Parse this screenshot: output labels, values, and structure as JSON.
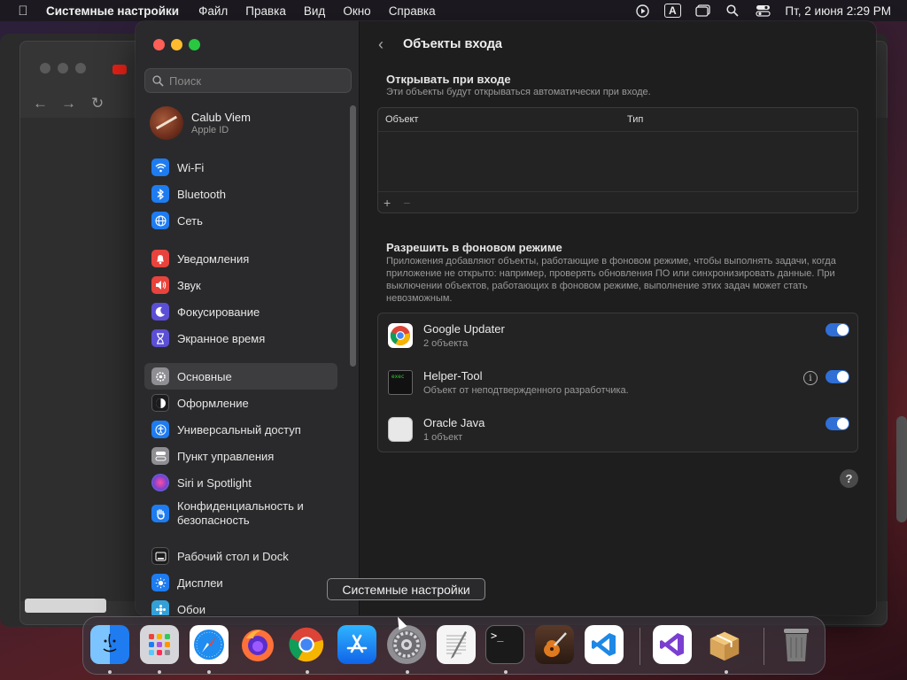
{
  "menubar": {
    "app_name": "Системные настройки",
    "items": [
      "Файл",
      "Правка",
      "Вид",
      "Окно",
      "Справка"
    ],
    "clock": "Пт, 2 июня  2:29 PM",
    "keyboard_indicator": "A"
  },
  "sidebar": {
    "search_placeholder": "Поиск",
    "user": {
      "name": "Calub Viem",
      "subtitle": "Apple ID"
    },
    "groups": [
      [
        {
          "label": "Wi-Fi",
          "icon": "wifi-icon",
          "color": "#1e7cf0"
        },
        {
          "label": "Bluetooth",
          "icon": "bluetooth-icon",
          "color": "#1e7cf0"
        },
        {
          "label": "Сеть",
          "icon": "globe-icon",
          "color": "#1e7cf0"
        }
      ],
      [
        {
          "label": "Уведомления",
          "icon": "bell-icon",
          "color": "#e8433c"
        },
        {
          "label": "Звук",
          "icon": "speaker-icon",
          "color": "#e8433c"
        },
        {
          "label": "Фокусирование",
          "icon": "moon-icon",
          "color": "#5b4fd6"
        },
        {
          "label": "Экранное время",
          "icon": "hourglass-icon",
          "color": "#5b4fd6"
        }
      ],
      [
        {
          "label": "Основные",
          "icon": "gear-icon",
          "color": "#8e8e93"
        },
        {
          "label": "Оформление",
          "icon": "appearance-icon",
          "color": "#1c1c1e"
        },
        {
          "label": "Универсальный доступ",
          "icon": "accessibility-icon",
          "color": "#1e7cf0"
        },
        {
          "label": "Пункт управления",
          "icon": "control-center-icon",
          "color": "#8e8e93"
        },
        {
          "label": "Siri и Spotlight",
          "icon": "siri-icon",
          "color": "#7a3fd0"
        },
        {
          "label": "Конфиденциальность и безопасность",
          "icon": "hand-icon",
          "color": "#1e7cf0"
        }
      ],
      [
        {
          "label": "Рабочий стол и Dock",
          "icon": "dock-icon",
          "color": "#1c1c1e"
        },
        {
          "label": "Дисплеи",
          "icon": "sun-icon",
          "color": "#1e7cf0"
        },
        {
          "label": "Обои",
          "icon": "wallpaper-icon",
          "color": "#34a0d8"
        }
      ]
    ]
  },
  "content": {
    "title": "Объекты входа",
    "login": {
      "title": "Открывать при входе",
      "subtitle": "Эти объекты будут открываться автоматически при входе.",
      "col_item": "Объект",
      "col_type": "Тип",
      "add": "+",
      "remove": "−"
    },
    "background": {
      "title": "Разрешить в фоновом режиме",
      "description": "Приложения добавляют объекты, работающие в фоновом режиме, чтобы выполнять задачи, когда приложение не открыто: например, проверять обновления ПО или синхронизировать данные. При выключении объектов, работающих в фоновом режиме, выполнение этих задач может стать невозможным.",
      "items": [
        {
          "name": "Google Updater",
          "detail": "2 объекта",
          "enabled": true
        },
        {
          "name": "Helper-Tool",
          "detail": "Объект от неподтвержденного разработчика.",
          "enabled": true
        },
        {
          "name": "Oracle Java",
          "detail": "1 объект",
          "enabled": true
        }
      ]
    },
    "help": "?"
  },
  "tooltip": "Системные настройки",
  "dock": {
    "apps": [
      "finder-icon",
      "launchpad-icon",
      "safari-icon",
      "firefox-icon",
      "chrome-icon",
      "app-store-icon",
      "system-settings-icon",
      "textedit-icon",
      "terminal-icon",
      "garageband-icon",
      "vscode-icon",
      "visual-studio-icon",
      "installer-icon",
      "trash-icon"
    ]
  }
}
